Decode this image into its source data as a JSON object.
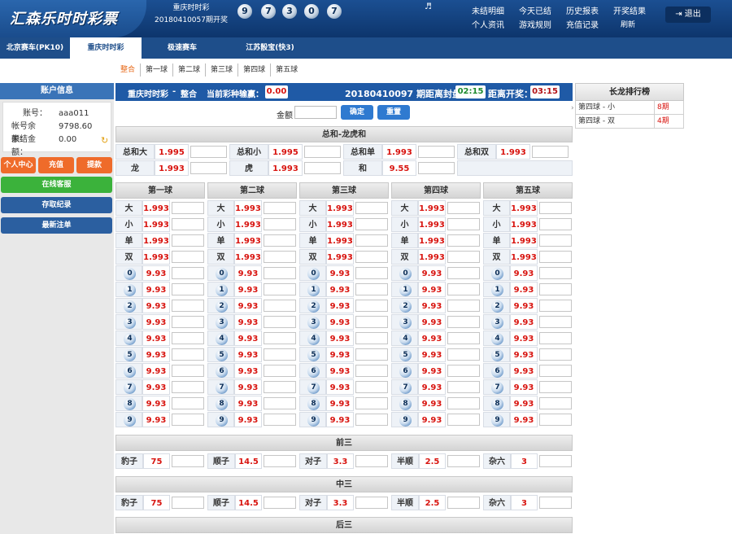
{
  "header": {
    "logo": "汇森乐时时彩票",
    "lottery_name": "重庆时时彩",
    "issue_text": "20180410057期开奖",
    "draw_numbers": [
      "9",
      "7",
      "3",
      "0",
      "7"
    ],
    "links": [
      "未结明细",
      "今天已结",
      "历史报表",
      "开奖结果",
      "个人资讯",
      "游戏规则",
      "充值记录",
      "刷新"
    ],
    "logout": "退出"
  },
  "nav": {
    "tabs": [
      "北京赛车(PK10)",
      "重庆时时彩",
      "极速赛车",
      "江苏骰宝(快3)"
    ],
    "active": 1
  },
  "subtabs": [
    "整合",
    "第一球",
    "第二球",
    "第三球",
    "第四球",
    "第五球"
  ],
  "account": {
    "title": "账户信息",
    "fields": [
      {
        "label": "账号：",
        "value": "aaa011"
      },
      {
        "label": "帐号余额：",
        "value": "9798.60"
      },
      {
        "label": "未结金额：",
        "value": "0.00"
      }
    ],
    "buttons": [
      "个人中心",
      "充值",
      "提款"
    ],
    "links": [
      "在线客服",
      "存取纪录",
      "最新注单"
    ]
  },
  "bet_header": {
    "game": "重庆时时彩",
    "sep": "-",
    "mode": "整合",
    "winloss_label": "当前彩种输赢：",
    "winloss": "0.00",
    "close_label": "20180410097 期距离封盘：",
    "close_time": "02:15",
    "open_label": "距离开奖：",
    "open_time": "03:15"
  },
  "amount": {
    "label": "金额",
    "confirm": "确定",
    "reset": "重置"
  },
  "sum_section": {
    "title": "总和-龙虎和",
    "row1": [
      [
        "总和大",
        "1.995"
      ],
      [
        "总和小",
        "1.995"
      ],
      [
        "总和单",
        "1.993"
      ],
      [
        "总和双",
        "1.993"
      ]
    ],
    "row2": [
      [
        "龙",
        "1.993"
      ],
      [
        "虎",
        "1.993"
      ],
      [
        "和",
        "9.55"
      ]
    ]
  },
  "balls": {
    "titles": [
      "第一球",
      "第二球",
      "第三球",
      "第四球",
      "第五球"
    ],
    "bs_labels": [
      "大",
      "小",
      "单",
      "双"
    ],
    "bs_odds": "1.993",
    "numbers": [
      "0",
      "1",
      "2",
      "3",
      "4",
      "5",
      "6",
      "7",
      "8",
      "9"
    ],
    "num_odds": "9.93"
  },
  "combos": [
    {
      "title": "前三",
      "items": [
        [
          "豹子",
          "75"
        ],
        [
          "顺子",
          "14.5"
        ],
        [
          "对子",
          "3.3"
        ],
        [
          "半顺",
          "2.5"
        ],
        [
          "杂六",
          "3"
        ]
      ]
    },
    {
      "title": "中三",
      "items": [
        [
          "豹子",
          "75"
        ],
        [
          "顺子",
          "14.5"
        ],
        [
          "对子",
          "3.3"
        ],
        [
          "半顺",
          "2.5"
        ],
        [
          "杂六",
          "3"
        ]
      ]
    },
    {
      "title": "后三",
      "items": []
    }
  ],
  "dragon": {
    "title": "长龙排行榜",
    "rows": [
      [
        "第四球 - 小",
        "8期"
      ],
      [
        "第四球 - 双",
        "4期"
      ]
    ]
  },
  "colors": {
    "header": "#0d356c",
    "nav": "#1e4e8a",
    "odds": "#d8140f",
    "orange": "#ef6b2a",
    "green": "#3bb23b"
  }
}
